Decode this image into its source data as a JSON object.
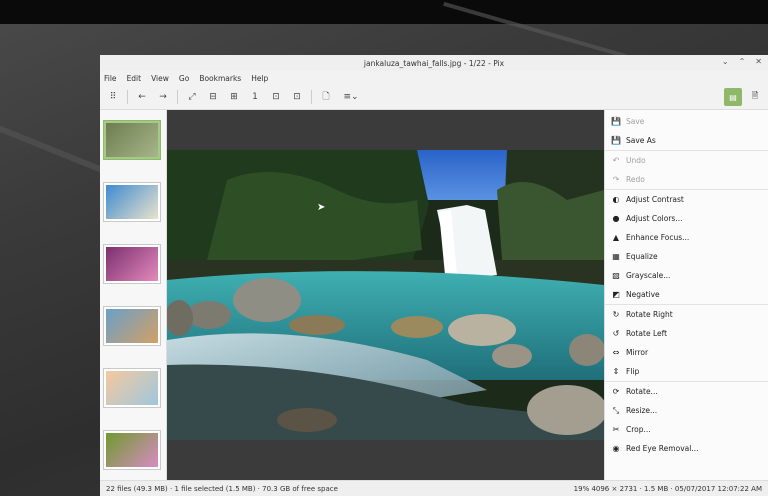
{
  "window": {
    "title": "jankaluza_tawhai_falls.jpg - 1/22 - Pix",
    "controls": {
      "minimize": "⌄",
      "maximize": "⌃",
      "close": "✕"
    }
  },
  "menubar": [
    "File",
    "Edit",
    "View",
    "Go",
    "Bookmarks",
    "Help"
  ],
  "toolbar": {
    "icons": [
      "browser-icon",
      "back-icon",
      "forward-icon",
      "fullscreen-icon",
      "zoom-fit-icon",
      "zoom-in-icon",
      "zoom-actual-icon",
      "zoom-width-icon",
      "zoom-height-icon",
      "properties-icon",
      "menu-icon"
    ],
    "glyphs": {
      "browser": "⠿",
      "back": "←",
      "forward": "→",
      "fullscreen": "⤢",
      "zoom_fit": "⊟",
      "zoom_in": "⊞",
      "zoom_actual": "1",
      "zoom_width": "⊡",
      "zoom_height": "⊡",
      "properties": "🗋",
      "menu": "≡⌄",
      "sidebar_toggle": "▤",
      "info_toggle": "🗎"
    },
    "accent": "#8fb86a"
  },
  "thumbnails": [
    {
      "name": "waterfall",
      "colors": [
        "#6c7d4f",
        "#a7b68a"
      ],
      "selected": true
    },
    {
      "name": "beach",
      "colors": [
        "#3f8bd0",
        "#e9e2cc"
      ],
      "selected": false
    },
    {
      "name": "pink-flowers",
      "colors": [
        "#7c2f6f",
        "#e38abc"
      ],
      "selected": false
    },
    {
      "name": "house-tree",
      "colors": [
        "#6aa0c9",
        "#d2a064"
      ],
      "selected": false
    },
    {
      "name": "sunset-sea",
      "colors": [
        "#f5c8a0",
        "#9fc7dd"
      ],
      "selected": false
    },
    {
      "name": "flower-green",
      "colors": [
        "#6f9b2e",
        "#d88bc3"
      ],
      "selected": false
    }
  ],
  "tools_menu": [
    {
      "label": "Save",
      "icon": "save-icon",
      "glyph": "💾",
      "disabled": true
    },
    {
      "label": "Save As",
      "icon": "save-as-icon",
      "glyph": "💾",
      "disabled": false,
      "sep_after": true
    },
    {
      "label": "Undo",
      "icon": "undo-icon",
      "glyph": "↶",
      "disabled": true
    },
    {
      "label": "Redo",
      "icon": "redo-icon",
      "glyph": "↷",
      "disabled": true,
      "sep_after": true
    },
    {
      "label": "Adjust Contrast",
      "icon": "contrast-icon",
      "glyph": "◐",
      "disabled": false
    },
    {
      "label": "Adjust Colors...",
      "icon": "colors-icon",
      "glyph": "●",
      "disabled": false
    },
    {
      "label": "Enhance Focus...",
      "icon": "focus-icon",
      "glyph": "▲",
      "disabled": false
    },
    {
      "label": "Equalize",
      "icon": "equalize-icon",
      "glyph": "▦",
      "disabled": false
    },
    {
      "label": "Grayscale...",
      "icon": "grayscale-icon",
      "glyph": "▧",
      "disabled": false
    },
    {
      "label": "Negative",
      "icon": "negative-icon",
      "glyph": "◩",
      "disabled": false,
      "sep_after": true
    },
    {
      "label": "Rotate Right",
      "icon": "rotate-right-icon",
      "glyph": "↻",
      "disabled": false
    },
    {
      "label": "Rotate Left",
      "icon": "rotate-left-icon",
      "glyph": "↺",
      "disabled": false
    },
    {
      "label": "Mirror",
      "icon": "mirror-icon",
      "glyph": "⇔",
      "disabled": false
    },
    {
      "label": "Flip",
      "icon": "flip-icon",
      "glyph": "⇕",
      "disabled": false,
      "sep_after": true
    },
    {
      "label": "Rotate...",
      "icon": "rotate-icon",
      "glyph": "⟳",
      "disabled": false
    },
    {
      "label": "Resize...",
      "icon": "resize-icon",
      "glyph": "⤡",
      "disabled": false
    },
    {
      "label": "Crop...",
      "icon": "crop-icon",
      "glyph": "✂",
      "disabled": false
    },
    {
      "label": "Red Eye Removal...",
      "icon": "red-eye-icon",
      "glyph": "◉",
      "disabled": false
    }
  ],
  "status": {
    "left": "22 files (49.3 MB) · 1 file selected (1.5 MB) · 70.3 GB of free space",
    "right": "19%  4096 × 2731 · 1.5 MB · 05/07/2017 12:07:22 AM"
  }
}
